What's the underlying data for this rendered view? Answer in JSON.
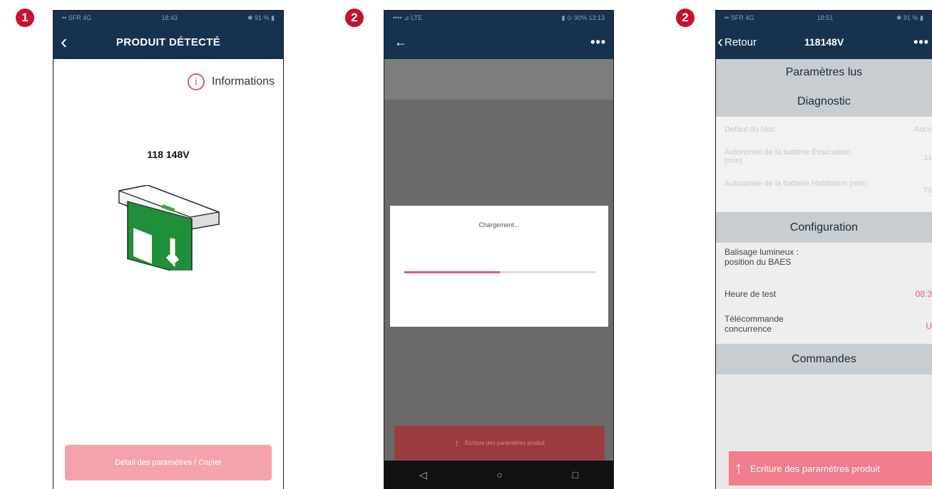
{
  "badges": {
    "b1": "1",
    "b2": "2",
    "b3": "2"
  },
  "colors": {
    "navbar": "#16324f",
    "accent": "#e25a6a",
    "button_light": "#f4a3ad",
    "progress": "#e2587e"
  },
  "screen1": {
    "status_left": "•• SFR 4G",
    "status_time": "18:43",
    "status_right": "✱ 91 % ▮",
    "back_icon": "chevron-left-icon",
    "title": "PRODUIT DÉTECTÉ",
    "info_label": "Informations",
    "product_name": "118 148V",
    "detail_button": "Détail des paramètres / Copier"
  },
  "screen2": {
    "status_left": "••••  ⊿ LTE",
    "status_right": "▮ ⊙ 90% 13:13",
    "more_label": "•••",
    "loading_label": "Chargement...",
    "progress": 0.5,
    "write_button": "Écriture des paramètres produit",
    "android_back": "◁",
    "android_home": "○",
    "android_recent": "□"
  },
  "screen3": {
    "status_left": "•• SFR 4G",
    "status_time": "18:51",
    "status_right": "✱ 91 % ▮",
    "back_label": "Retour",
    "title": "118148V",
    "more_label": "•••",
    "section_read": "Paramètres lus",
    "section_diag": "Diagnostic",
    "diag_rows": [
      {
        "label": "Defaut du bloc",
        "value": "Aucu"
      },
      {
        "label": "Autonomie de la batterie Évacuation (min)",
        "value": "11"
      },
      {
        "label": "Autonomie de la batterie Habitation (min)",
        "value": "78"
      }
    ],
    "section_config": "Configuration",
    "config_rows": [
      {
        "label": "Balisage lumineux : position du BAES",
        "value": ""
      },
      {
        "label": "Heure de test",
        "value": "08:3"
      },
      {
        "label": "Télécommande concurrence",
        "value": "U"
      }
    ],
    "section_commands": "Commandes",
    "write_button": "Écriture des paramètres produit"
  }
}
